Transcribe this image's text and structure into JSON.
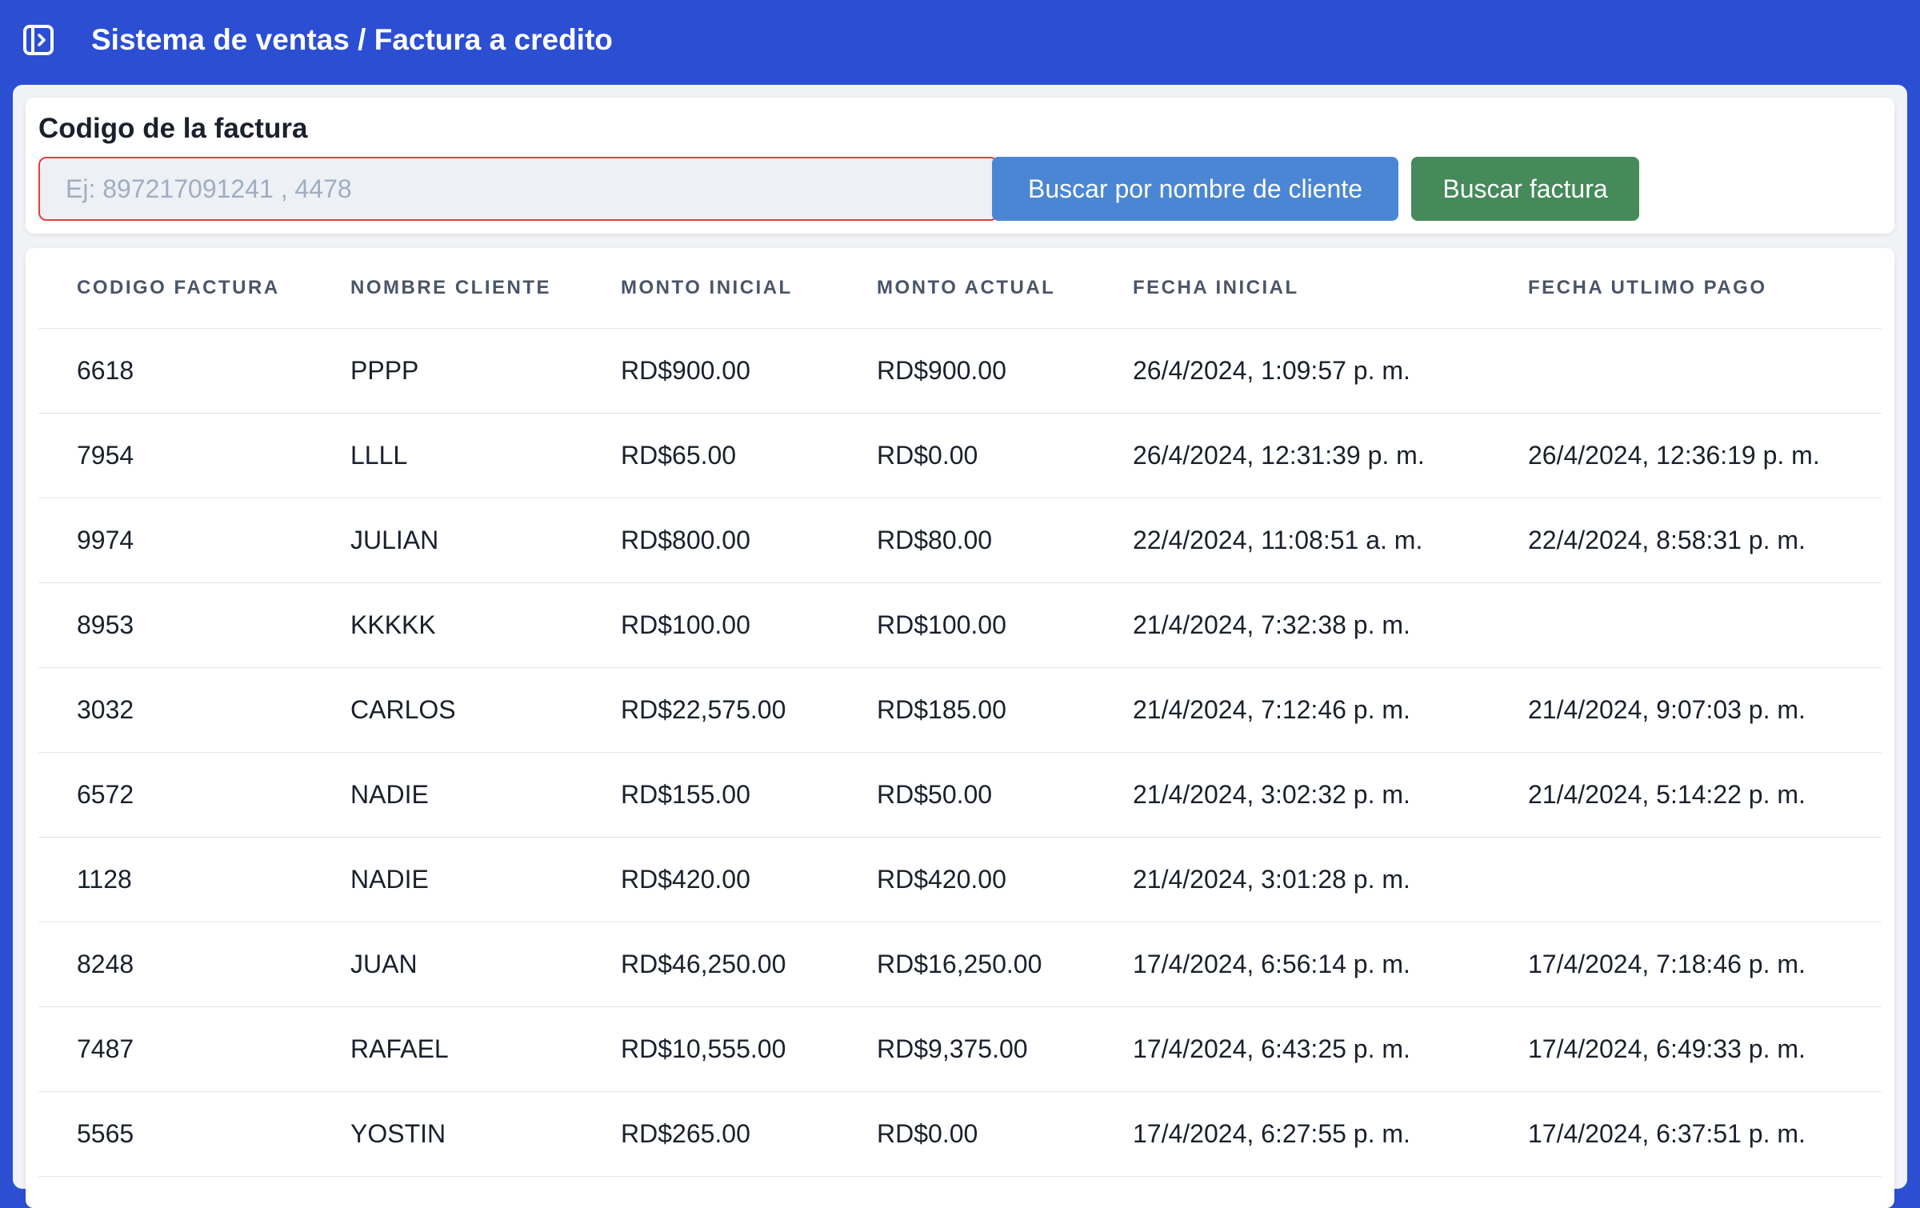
{
  "header": {
    "title": "Sistema de ventas / Factura a credito",
    "toggle_icon": "sidebar-toggle-icon",
    "background": "#2b4ed2"
  },
  "search": {
    "label": "Codigo de la factura",
    "input_value": "",
    "placeholder": "Ej: 897217091241 , 4478",
    "client_button_label": "Buscar por nombre de cliente",
    "invoice_button_label": "Buscar factura"
  },
  "colors": {
    "primary_blue": "#2b4ed2",
    "client_button": "#4a86d4",
    "invoice_button": "#458a59",
    "input_border_error": "#e53e3e"
  },
  "table": {
    "headers": [
      "CODIGO FACTURA",
      "NOMBRE CLIENTE",
      "MONTO INICIAL",
      "MONTO ACTUAL",
      "FECHA INICIAL",
      "FECHA UTLIMO PAGO"
    ],
    "rows": [
      [
        "6618",
        "PPPP",
        "RD$900.00",
        "RD$900.00",
        "26/4/2024, 1:09:57 p. m.",
        ""
      ],
      [
        "7954",
        "LLLL",
        "RD$65.00",
        "RD$0.00",
        "26/4/2024, 12:31:39 p. m.",
        "26/4/2024, 12:36:19 p. m."
      ],
      [
        "9974",
        "JULIAN",
        "RD$800.00",
        "RD$80.00",
        "22/4/2024, 11:08:51 a. m.",
        "22/4/2024, 8:58:31 p. m."
      ],
      [
        "8953",
        "KKKKK",
        "RD$100.00",
        "RD$100.00",
        "21/4/2024, 7:32:38 p. m.",
        ""
      ],
      [
        "3032",
        "CARLOS",
        "RD$22,575.00",
        "RD$185.00",
        "21/4/2024, 7:12:46 p. m.",
        "21/4/2024, 9:07:03 p. m."
      ],
      [
        "6572",
        "NADIE",
        "RD$155.00",
        "RD$50.00",
        "21/4/2024, 3:02:32 p. m.",
        "21/4/2024, 5:14:22 p. m."
      ],
      [
        "1128",
        "NADIE",
        "RD$420.00",
        "RD$420.00",
        "21/4/2024, 3:01:28 p. m.",
        ""
      ],
      [
        "8248",
        "JUAN",
        "RD$46,250.00",
        "RD$16,250.00",
        "17/4/2024, 6:56:14 p. m.",
        "17/4/2024, 7:18:46 p. m."
      ],
      [
        "7487",
        "RAFAEL",
        "RD$10,555.00",
        "RD$9,375.00",
        "17/4/2024, 6:43:25 p. m.",
        "17/4/2024, 6:49:33 p. m."
      ],
      [
        "5565",
        "YOSTIN",
        "RD$265.00",
        "RD$0.00",
        "17/4/2024, 6:27:55 p. m.",
        "17/4/2024, 6:37:51 p. m."
      ]
    ]
  }
}
